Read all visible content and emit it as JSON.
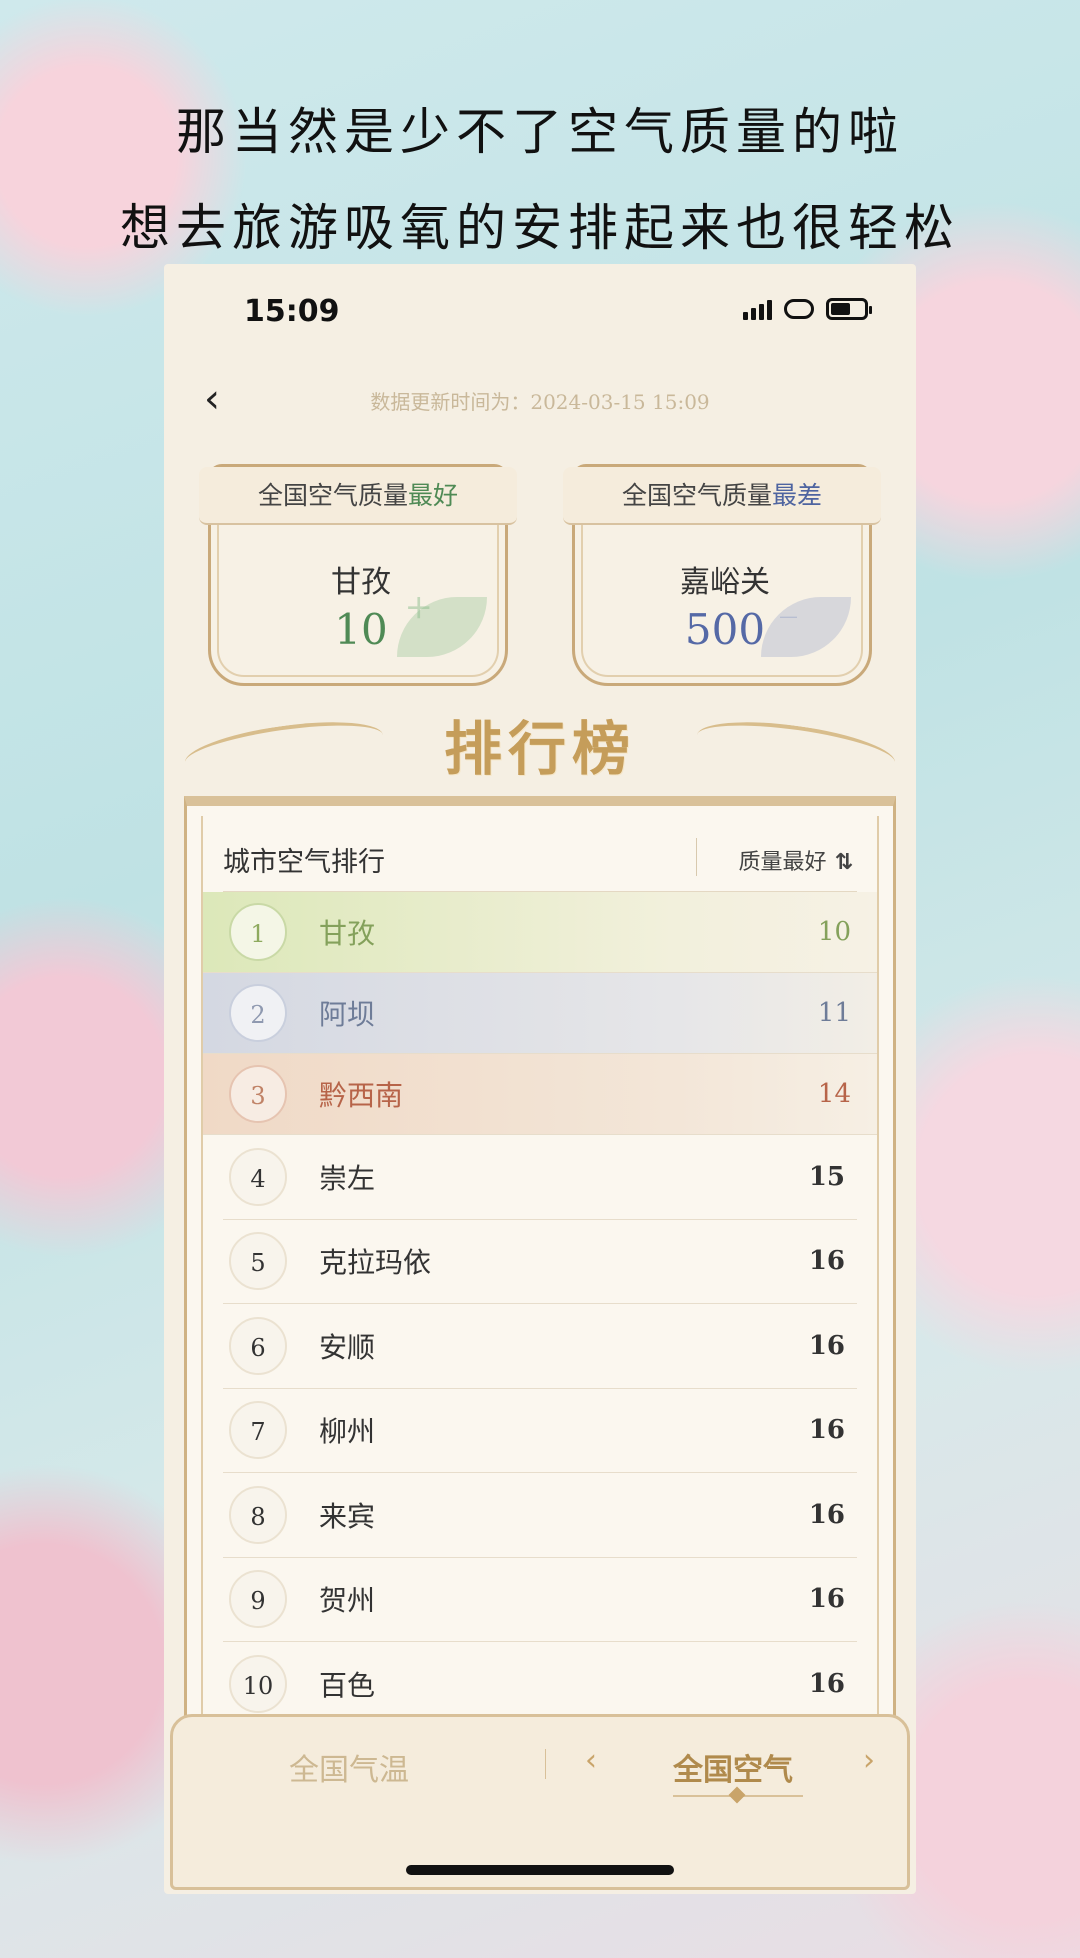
{
  "caption": {
    "line1": "那当然是少不了空气质量的啦",
    "line2": "想去旅游吸氧的安排起来也很轻松"
  },
  "status_bar": {
    "time": "15:09",
    "icons": [
      "signal-icon",
      "link-icon",
      "battery-icon"
    ]
  },
  "header": {
    "back_label": "‹",
    "update_time": "数据更新时间为：2024-03-15 15:09"
  },
  "best_card": {
    "title_prefix": "全国空气质量",
    "title_highlight": "最好",
    "city": "甘孜",
    "value": "10",
    "sign": "+"
  },
  "worst_card": {
    "title_prefix": "全国空气质量",
    "title_highlight": "最差",
    "city": "嘉峪关",
    "value": "500",
    "sign": "_"
  },
  "ranking": {
    "banner_title": "排行榜",
    "list_title": "城市空气排行",
    "sort_label": "质量最好",
    "sort_icon": "⇅",
    "rows": [
      {
        "rank": "1",
        "city": "甘孜",
        "value": "10"
      },
      {
        "rank": "2",
        "city": "阿坝",
        "value": "11"
      },
      {
        "rank": "3",
        "city": "黔西南",
        "value": "14"
      },
      {
        "rank": "4",
        "city": "崇左",
        "value": "15"
      },
      {
        "rank": "5",
        "city": "克拉玛依",
        "value": "16"
      },
      {
        "rank": "6",
        "city": "安顺",
        "value": "16"
      },
      {
        "rank": "7",
        "city": "柳州",
        "value": "16"
      },
      {
        "rank": "8",
        "city": "来宾",
        "value": "16"
      },
      {
        "rank": "9",
        "city": "贺州",
        "value": "16"
      },
      {
        "rank": "10",
        "city": "百色",
        "value": "16"
      }
    ]
  },
  "tabs": {
    "temperature": "全国气温",
    "air": "全国空气",
    "arrow_left": "‹",
    "arrow_right": "›"
  },
  "colors": {
    "best": "#4f8a55",
    "worst": "#5569a6",
    "gold": "#c59d5a"
  }
}
